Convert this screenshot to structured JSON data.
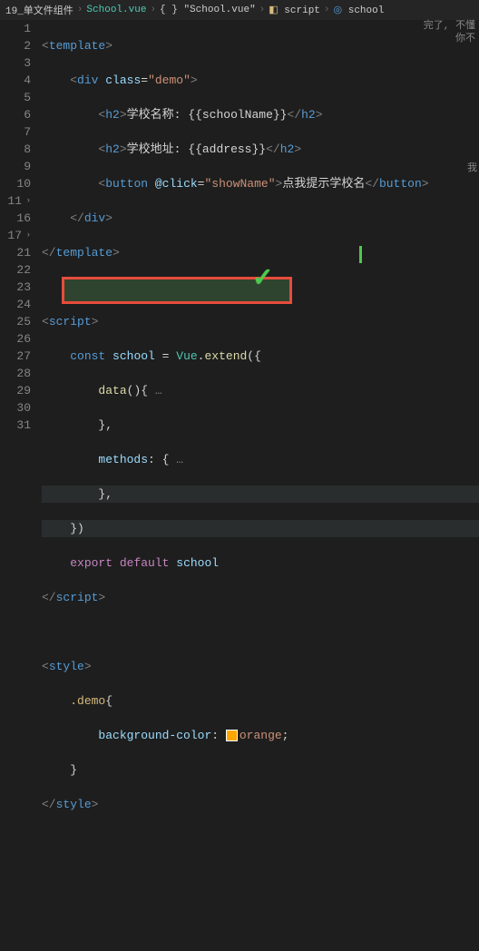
{
  "breadcrumb": {
    "p1": "19_单文件组件",
    "p2": "School.vue",
    "p3": "{ } \"School.vue\"",
    "p4": "script",
    "p5": "school"
  },
  "gutter": {
    "l1": "1",
    "l2": "2",
    "l3": "3",
    "l4": "4",
    "l5": "5",
    "l6": "6",
    "l7": "7",
    "l8": "8",
    "l9": "9",
    "l10": "10",
    "l11": "11",
    "l16": "16",
    "l17": "17",
    "l21": "21",
    "l22": "22",
    "l23": "23",
    "l24": "24",
    "l25": "25",
    "l26": "26",
    "l27": "27",
    "l28": "28",
    "l29": "29",
    "l30": "30",
    "l31": "31"
  },
  "code": {
    "template_open_l": "<",
    "template_open": "template",
    "template_open_r": ">",
    "div_open_l": "<",
    "div_open": "div",
    "div_class_attr": "class",
    "div_class_eq": "=",
    "div_class_val": "\"demo\"",
    "div_open_r": ">",
    "h2a_l": "<",
    "h2a": "h2",
    "h2a_r": ">",
    "h2a_txt": "学校名称: ",
    "h2a_exp": "{{schoolName}}",
    "h2a_cl": "</",
    "h2a_c": "h2",
    "h2a_cr": ">",
    "h2b_l": "<",
    "h2b": "h2",
    "h2b_r": ">",
    "h2b_txt": "学校地址: ",
    "h2b_exp": "{{address}}",
    "h2b_cl": "</",
    "h2b_c": "h2",
    "h2b_cr": ">",
    "btn_l": "<",
    "btn": "button",
    "btn_at": "@click",
    "btn_eq": "=",
    "btn_val": "\"showName\"",
    "btn_r": ">",
    "btn_txt": "点我提示学校名",
    "btn_cl": "</",
    "btn_c": "button",
    "btn_cr": ">",
    "div_cl": "</",
    "div_c": "div",
    "div_cr": ">",
    "tpl_cl": "</",
    "tpl_c": "template",
    "tpl_cr": ">",
    "script_l": "<",
    "script_t": "script",
    "script_r": ">",
    "const_kw": "const",
    "school_var": "school",
    "eq": " = ",
    "vue_cls": "Vue",
    "dot": ".",
    "extend_fn": "extend",
    "paren_open": "({",
    "data_fn": "data",
    "data_paren": "()",
    "data_brace": "{",
    "ellipsis": " …",
    "brace_close": "},",
    "methods_prop": "methods",
    "methods_colon": ": {",
    "ellipsis2": " …",
    "brace_close2": "},",
    "close_paren": "})",
    "export_kw": "export",
    "default_kw": "default",
    "school_ref": "school",
    "script_cl": "</",
    "script_ct": "script",
    "script_cr": ">",
    "style_l": "<",
    "style_t": "style",
    "style_r": ">",
    "demo_sel": ".demo",
    "demo_brace": "{",
    "bg_prop": "background-color",
    "bg_colon": ": ",
    "bg_val": "orange",
    "bg_semi": ";",
    "style_brace_close": "}",
    "style_cl": "</",
    "style_ct": "style",
    "style_cr": ">"
  },
  "floating": {
    "l1": "完了, 不懂",
    "l2": "你不",
    "r": "我"
  },
  "chart_data": null
}
